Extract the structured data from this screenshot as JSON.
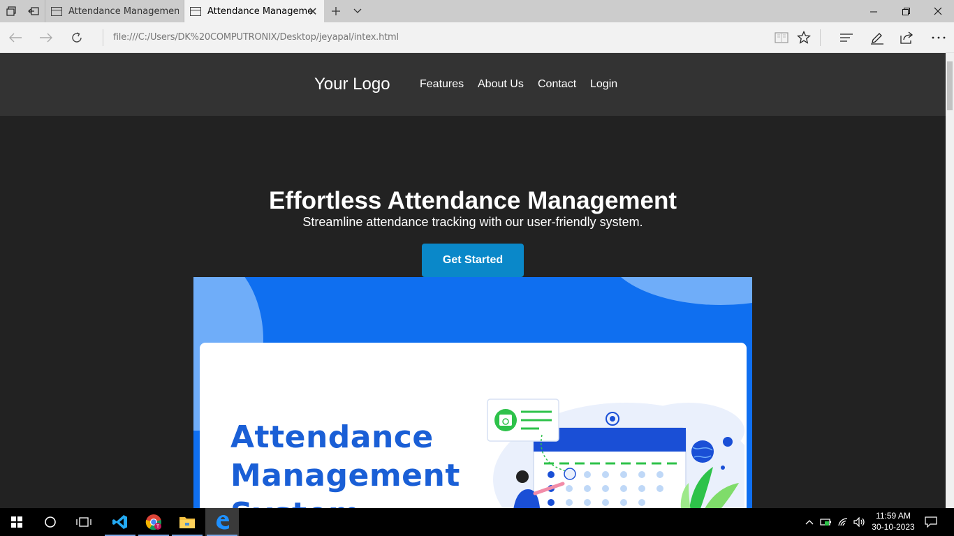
{
  "browser": {
    "tabs": [
      {
        "title": "Attendance Management Sy",
        "active": false
      },
      {
        "title": "Attendance Manageme",
        "active": true
      }
    ],
    "url": "file:///C:/Users/DK%20COMPUTRONIX/Desktop/jeyapal/intex.html"
  },
  "site": {
    "logo": "Your Logo",
    "nav": [
      "Features",
      "About Us",
      "Contact",
      "Login"
    ],
    "hero_title": "Effortless Attendance Management",
    "hero_subtitle": "Streamline attendance tracking with our user-friendly system.",
    "cta_label": "Get Started",
    "banner_title_lines": [
      "Attendance",
      "Management",
      "System"
    ]
  },
  "colors": {
    "page_bg": "#222222",
    "header_bg": "#333333",
    "cta_bg": "#0a88c9",
    "banner_blue": "#0f6ff0",
    "banner_title": "#1a5fd6",
    "accent_green": "#2ec24a"
  },
  "taskbar": {
    "apps": [
      "vscode-icon",
      "chrome-icon",
      "file-explorer-icon",
      "edge-icon"
    ],
    "time": "11:59 AM",
    "date": "30-10-2023"
  }
}
